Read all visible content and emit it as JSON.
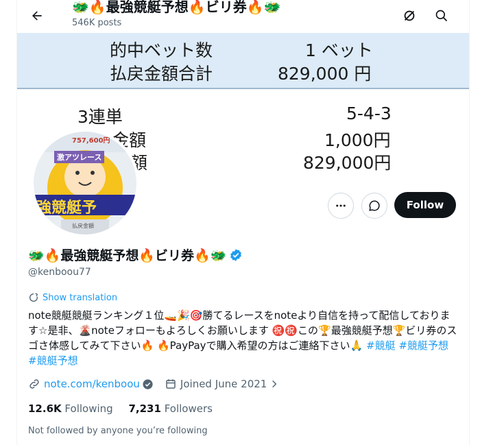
{
  "header": {
    "title": "🐲🔥最強競艇予想🔥ビリ券🔥🐲",
    "posts": "546K posts"
  },
  "banner": {
    "row1_label": "的中ベット数",
    "row1_value": "1 ベット",
    "row2_label": "払戻金額合計",
    "row2_value": "829,000 円",
    "row3_label": "3連単",
    "row3_value": "5-4-3",
    "row4_label": "金額",
    "row4_value": "1,000円",
    "row5_label": "額",
    "row5_value": "829,000円"
  },
  "avatar": {
    "top_text": "757,600円",
    "badge_text": "激アツレース",
    "big_text": "強競艇予",
    "bottom_text": "払戻金額"
  },
  "profile": {
    "display_name": "🐲🔥最強競艇予想🔥ビリ券🔥🐲",
    "handle": "@kenboou77",
    "follow_label": "Follow",
    "show_translation": "Show translation",
    "bio_1": "note競艇競艇ランキング１位🚤🎉🎯勝てるレースをnoteより自信を持って配信しております☆是非、🌋noteフォローもよろしくお願いします ㊗️㊗️この🏆最強競艇予想🏆ビリ券のスゴさ体感してみて下さい🔥 🔥PayPayで購入希望の方はご連絡下さい🙏 ",
    "tag1": "#競艇",
    "tag2": "#競艇予想",
    "tag3": "#競艇予想",
    "link": "note.com/kenboou",
    "joined": "Joined June 2021",
    "following_count": "12.6K",
    "following_label": "Following",
    "followers_count": "7,231",
    "followers_label": "Followers",
    "not_followed": "Not followed by anyone you’re following"
  },
  "colors": {
    "accent": "#1d9bf0",
    "band": "#dcebf7",
    "follow_bg": "#0f1419"
  }
}
